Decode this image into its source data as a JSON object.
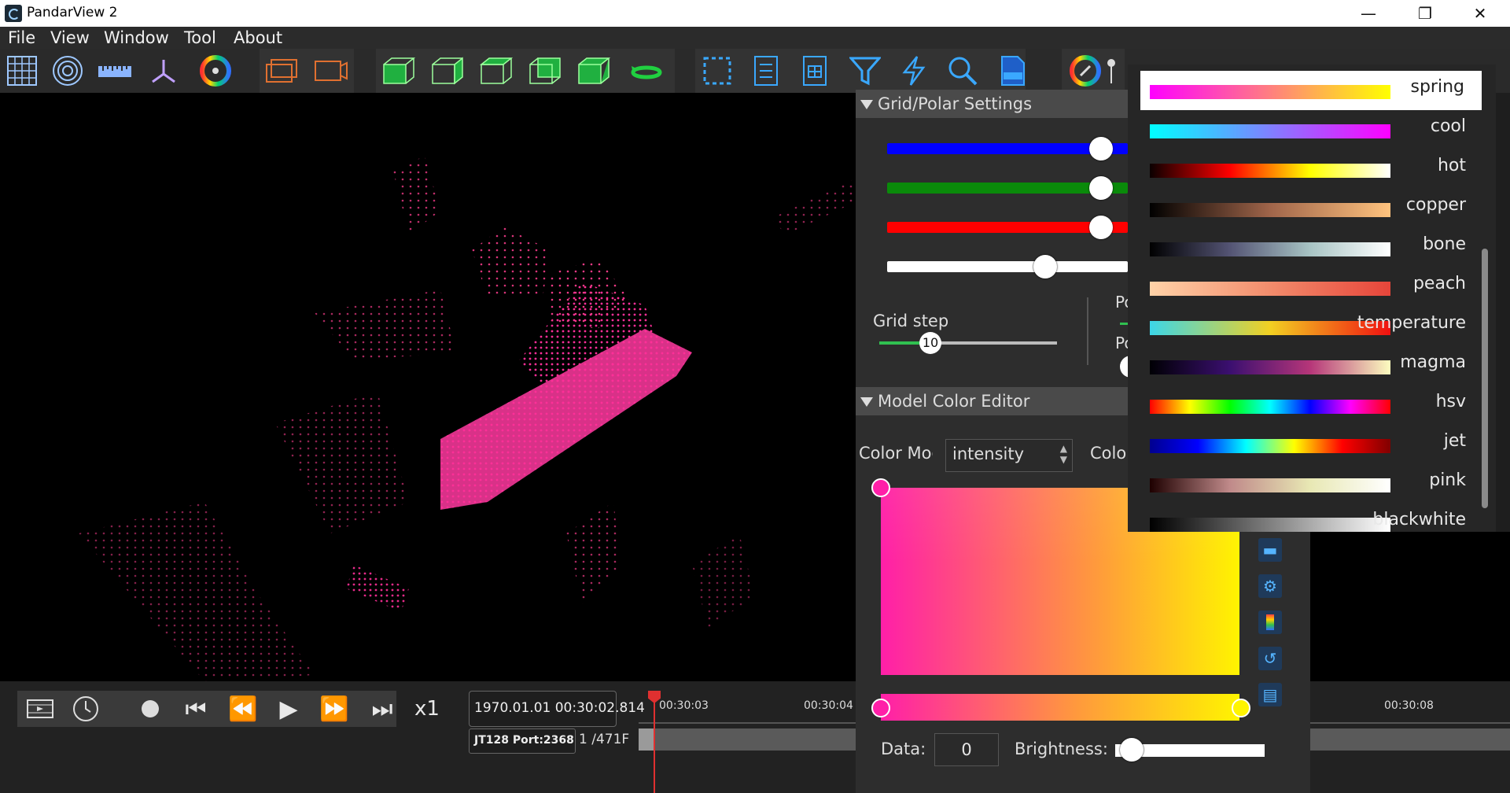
{
  "app": {
    "title": "PandarView 2"
  },
  "window_controls": {
    "minimize": "—",
    "maximize": "❐",
    "close": "✕"
  },
  "menu": [
    "File",
    "View",
    "Window",
    "Tool",
    "About"
  ],
  "toolbar": {
    "icons": [
      "grid-icon",
      "polar-icon",
      "ruler-icon",
      "axis-icon",
      "color-wheel-icon",
      "frame-icon",
      "frame-record-icon",
      "cube-front-icon",
      "cube-side-icon",
      "cube-top-icon",
      "cube-back-icon",
      "cube-iso-icon",
      "rotate-icon",
      "select-box-icon",
      "list-icon",
      "table-icon",
      "filter-icon",
      "lightning-icon",
      "search-icon",
      "pcd-icon",
      "palette-icon",
      "pin-icon"
    ]
  },
  "grid_polar": {
    "header": "Grid/Polar Settings",
    "grid_step_label": "Grid step",
    "grid_step_value": "10",
    "slider_levels": {
      "blue": 0.88,
      "green": 0.88,
      "red": 0.88,
      "white": 0.65,
      "grid_step": 0.3
    },
    "cut_label_1": "Po",
    "cut_label_2": "Po"
  },
  "model_color": {
    "header": "Model Color Editor",
    "color_mode_label": "Color Mode",
    "color_mode_value": "intensity",
    "color_label_2": "Colo",
    "data_label": "Data:",
    "data_value": "0",
    "brightness_label": "Brightness:",
    "brightness_level": 0.06,
    "colors": {
      "start": "#ff1fa8",
      "end": "#fff400"
    }
  },
  "colormaps": {
    "selected": "spring",
    "items": [
      {
        "name": "spring",
        "gradient": "linear-gradient(90deg,#ff00ff,#ff7f80,#ffff00)"
      },
      {
        "name": "cool",
        "gradient": "linear-gradient(90deg,#00ffff,#8080ff,#ff00ff)"
      },
      {
        "name": "hot",
        "gradient": "linear-gradient(90deg,#0b0000,#ff0000,#ffff00,#ffffff)"
      },
      {
        "name": "copper",
        "gradient": "linear-gradient(90deg,#000000,#a0654a,#ffc37e)"
      },
      {
        "name": "bone",
        "gradient": "linear-gradient(90deg,#000000,#545474,#a8c4c4,#ffffff)"
      },
      {
        "name": "peach",
        "gradient": "linear-gradient(90deg,#ffd2a8,#f28c6c,#e6453a)"
      },
      {
        "name": "temperature",
        "gradient": "linear-gradient(90deg,#3cd6e8,#f2d022,#f01010)"
      },
      {
        "name": "magma",
        "gradient": "linear-gradient(90deg,#000004,#3b0f70,#b63679,#fcfdbf)"
      },
      {
        "name": "hsv",
        "gradient": "linear-gradient(90deg,#ff0000,#ffff00,#00ff00,#00ffff,#0000ff,#ff00ff,#ff0000)"
      },
      {
        "name": "jet",
        "gradient": "linear-gradient(90deg,#00008f,#0000ff,#00ffff,#ffff00,#ff0000,#800000)"
      },
      {
        "name": "pink",
        "gradient": "linear-gradient(90deg,#1e0000,#c08a8a,#e8e8b4,#ffffff)"
      },
      {
        "name": "blackwhite",
        "gradient": "linear-gradient(90deg,#000000,#ffffff)"
      }
    ]
  },
  "playback": {
    "speed": "x1",
    "timestamp": "1970.01.01 00:30:02.814",
    "device": "JT128 Port:2368",
    "frame": "1 /471F",
    "timeline_ticks": [
      "00:30:03",
      "00:30:04",
      "00:30:08"
    ],
    "progress": 0.0
  }
}
